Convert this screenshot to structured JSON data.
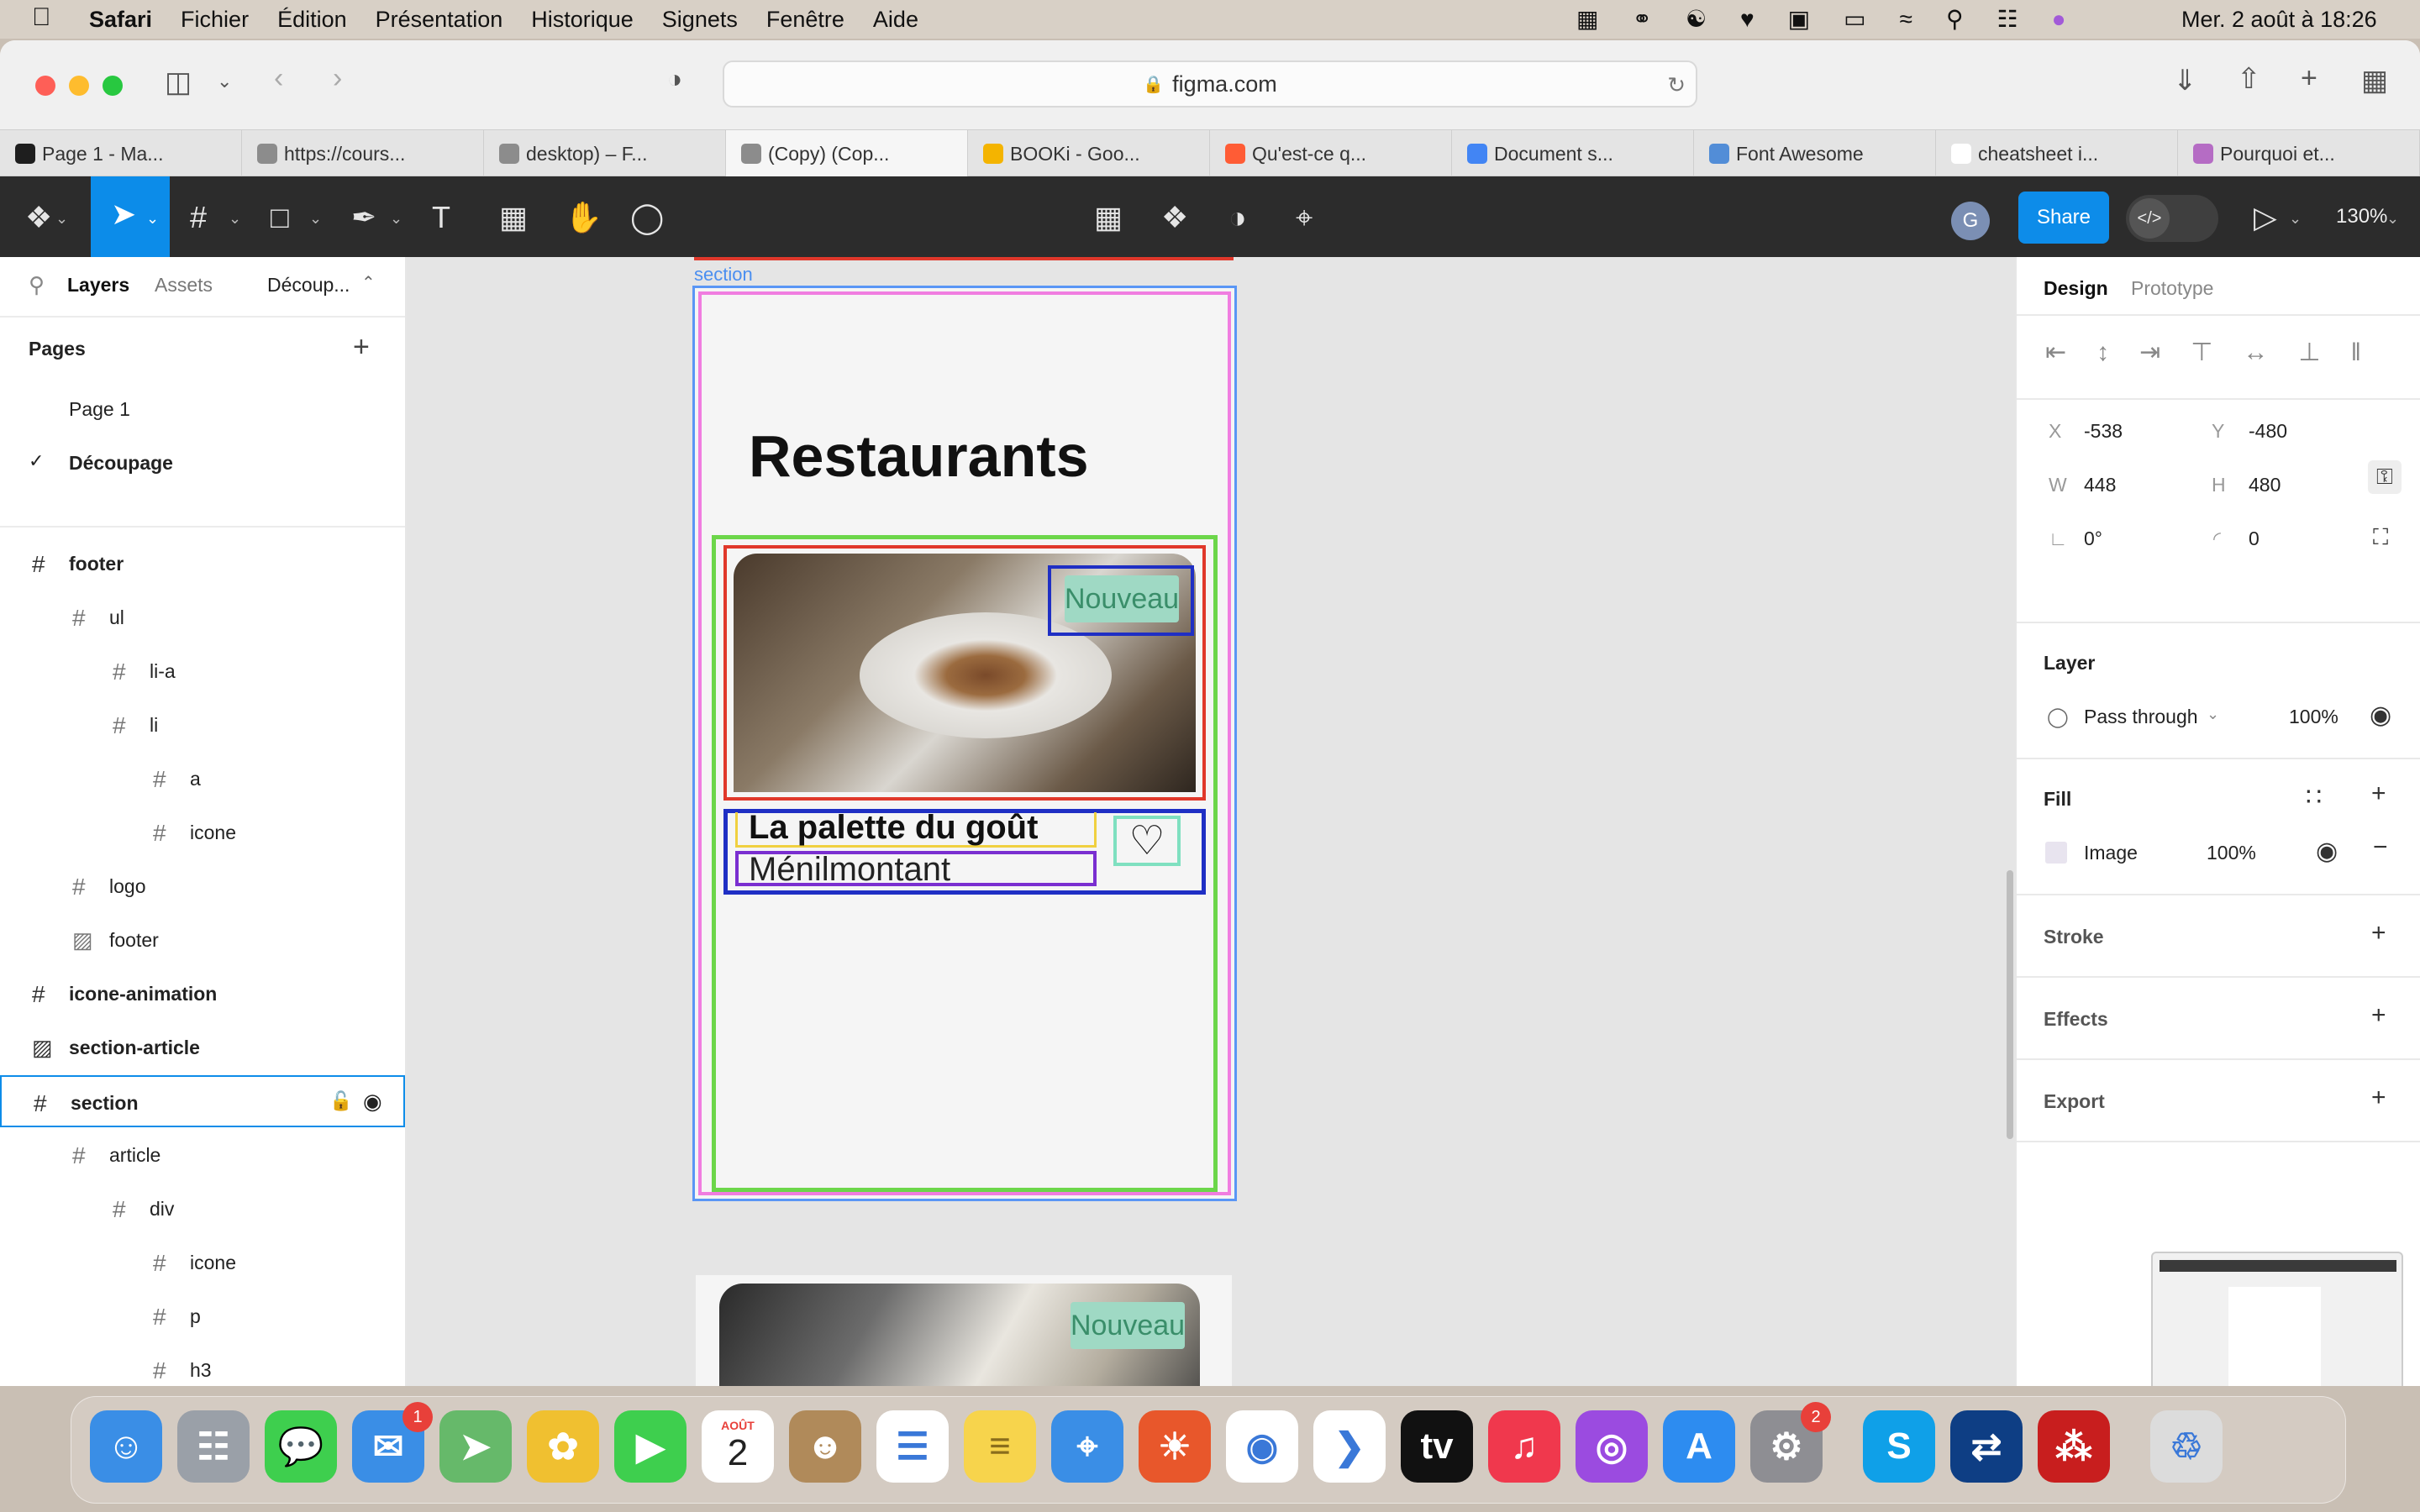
{
  "menubar": {
    "app": "Safari",
    "items": [
      "Fichier",
      "Édition",
      "Présentation",
      "Historique",
      "Signets",
      "Fenêtre",
      "Aide"
    ],
    "datetime": "Mer. 2 août à  18:26"
  },
  "safari": {
    "url": "figma.com",
    "tabs": [
      {
        "label": "Page 1 - Ma...",
        "icon": "figma-icon",
        "color": "#1e1e1e"
      },
      {
        "label": "https://cours...",
        "icon": "openclassrooms-icon",
        "color": "#8c8c8c"
      },
      {
        "label": "desktop) – F...",
        "icon": "figma-icon",
        "color": "#8c8c8c"
      },
      {
        "label": "(Copy) (Cop...",
        "icon": "figma-icon",
        "color": "#8c8c8c"
      },
      {
        "label": "BOOKi - Goo...",
        "icon": "slides-icon",
        "color": "#f4b400"
      },
      {
        "label": "Qu'est-ce q...",
        "icon": "hubspot-icon",
        "color": "#ff5c35"
      },
      {
        "label": "Document s...",
        "icon": "docs-icon",
        "color": "#4285f4"
      },
      {
        "label": "Font Awesome",
        "icon": "flag-icon",
        "color": "#528dd7"
      },
      {
        "label": "cheatsheet i...",
        "icon": "google-icon",
        "color": "#ffffff"
      },
      {
        "label": "Pourquoi et...",
        "icon": "butterfly-icon",
        "color": "#b56cc4"
      }
    ]
  },
  "figma": {
    "share_label": "Share",
    "avatar_letter": "G",
    "zoom": "130%",
    "left": {
      "tabs": {
        "layers": "Layers",
        "assets": "Assets",
        "page": "Découp..."
      },
      "pages_title": "Pages",
      "pages": [
        "Page 1",
        "Découpage"
      ],
      "layers": [
        {
          "label": "footer",
          "depth": 0,
          "kind": "frame"
        },
        {
          "label": "ul",
          "depth": 1,
          "kind": "frame"
        },
        {
          "label": "li-a",
          "depth": 2,
          "kind": "frame"
        },
        {
          "label": "li",
          "depth": 2,
          "kind": "frame"
        },
        {
          "label": "a",
          "depth": 3,
          "kind": "frame"
        },
        {
          "label": "icone",
          "depth": 3,
          "kind": "frame"
        },
        {
          "label": "logo",
          "depth": 1,
          "kind": "frame"
        },
        {
          "label": "footer",
          "depth": 1,
          "kind": "image"
        },
        {
          "label": "icone-animation",
          "depth": 0,
          "kind": "frame"
        },
        {
          "label": "section-article",
          "depth": 0,
          "kind": "image"
        },
        {
          "label": "section",
          "depth": 0,
          "kind": "frame",
          "selected": true
        },
        {
          "label": "article",
          "depth": 1,
          "kind": "frame"
        },
        {
          "label": "div",
          "depth": 2,
          "kind": "frame"
        },
        {
          "label": "icone",
          "depth": 3,
          "kind": "frame"
        },
        {
          "label": "p",
          "depth": 3,
          "kind": "frame"
        },
        {
          "label": "h3",
          "depth": 3,
          "kind": "frame"
        }
      ]
    },
    "canvas": {
      "section_label": "section",
      "heading": "Restaurants",
      "badge": "Nouveau",
      "card_title": "La palette du goût",
      "card_subtitle": "Ménilmontant",
      "badge2": "Nouveau"
    },
    "right": {
      "tabs": {
        "design": "Design",
        "prototype": "Prototype"
      },
      "x_label": "X",
      "x": "-538",
      "y_label": "Y",
      "y": "-480",
      "w_label": "W",
      "w": "448",
      "h_label": "H",
      "h": "480",
      "rotation": "0°",
      "radius": "0",
      "layer_title": "Layer",
      "blend": "Pass through",
      "opacity": "100%",
      "fill_title": "Fill",
      "fill_type": "Image",
      "fill_opacity": "100%",
      "stroke_title": "Stroke",
      "effects_title": "Effects",
      "export_title": "Export"
    }
  },
  "dock": {
    "apps": [
      {
        "name": "finder-icon",
        "color": "#3a8ee6"
      },
      {
        "name": "launchpad-icon",
        "color": "#9aa0a8"
      },
      {
        "name": "messages-icon",
        "color": "#3ecf4e"
      },
      {
        "name": "mail-icon",
        "color": "#3a8ee6",
        "badge": "1"
      },
      {
        "name": "maps-icon",
        "color": "#66b96a"
      },
      {
        "name": "photos-icon",
        "color": "#f0c030"
      },
      {
        "name": "facetime-icon",
        "color": "#3ecf4e"
      },
      {
        "name": "calendar-icon",
        "color": "#ffffff",
        "month": "AOÛT",
        "day": "2"
      },
      {
        "name": "contacts-icon",
        "color": "#b08a5a"
      },
      {
        "name": "reminders-icon",
        "color": "#ffffff"
      },
      {
        "name": "notes-icon",
        "color": "#f7d44c"
      },
      {
        "name": "safari-icon",
        "color": "#3a8ee6"
      },
      {
        "name": "firefox-icon",
        "color": "#e8572b"
      },
      {
        "name": "chrome-icon",
        "color": "#ffffff"
      },
      {
        "name": "vscode-icon",
        "color": "#ffffff"
      },
      {
        "name": "appletv-icon",
        "color": "#111111"
      },
      {
        "name": "music-icon",
        "color": "#f0384d"
      },
      {
        "name": "podcasts-icon",
        "color": "#9b4be0"
      },
      {
        "name": "appstore-icon",
        "color": "#2d8cf0"
      },
      {
        "name": "system-preferences-icon",
        "color": "#8e8e93",
        "badge": "2"
      },
      {
        "name": "skype-icon",
        "color": "#0fa0e8"
      },
      {
        "name": "teamviewer-icon",
        "color": "#0e3e84"
      },
      {
        "name": "acrobat-icon",
        "color": "#c81e1e"
      },
      {
        "name": "trash-icon",
        "color": "#dcdcdc"
      }
    ]
  }
}
